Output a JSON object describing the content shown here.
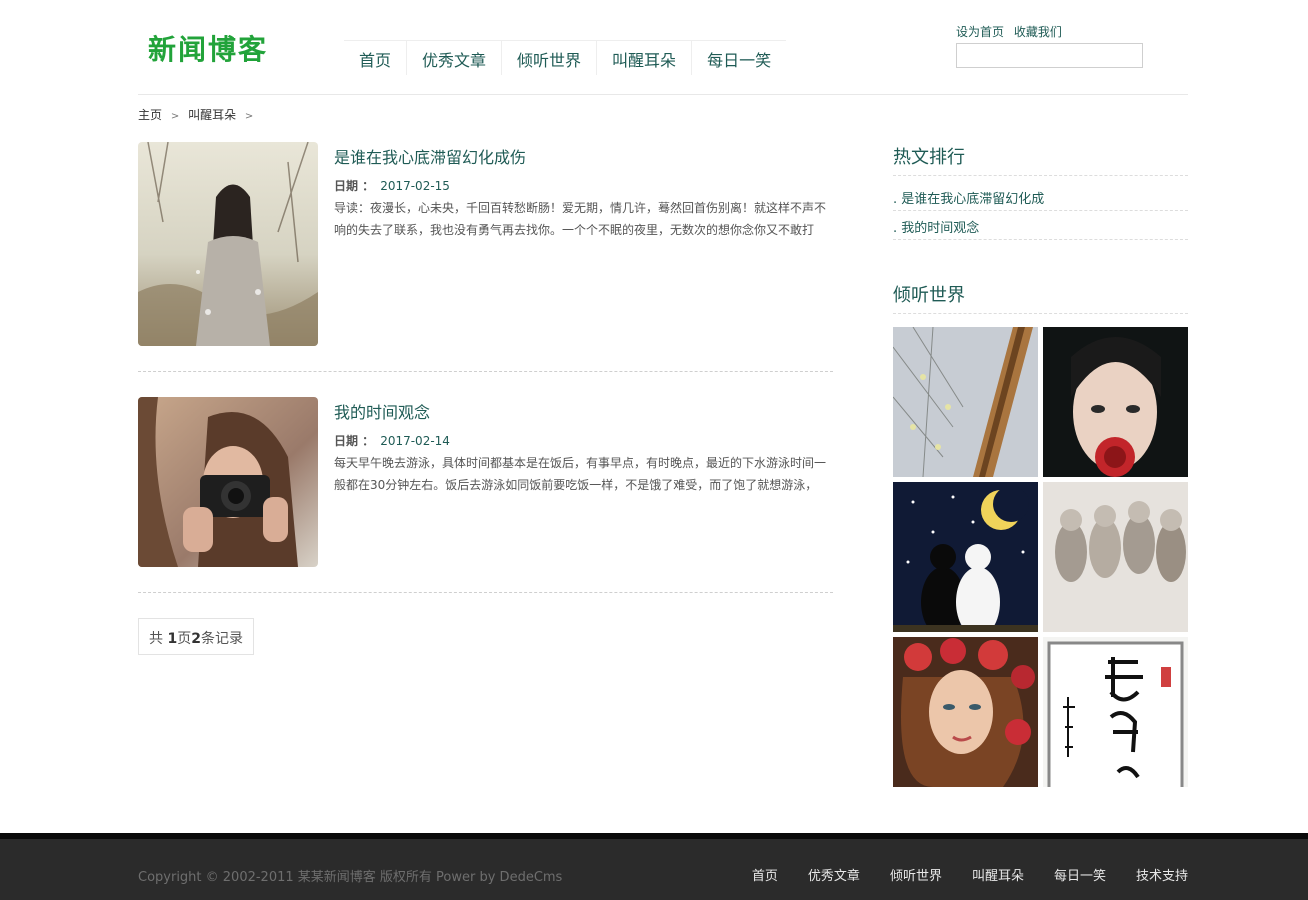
{
  "header": {
    "logo_text": "新闻博客",
    "nav": [
      "首页",
      "优秀文章",
      "倾听世界",
      "叫醒耳朵",
      "每日一笑"
    ],
    "top_links": [
      "设为首页",
      "收藏我们"
    ],
    "search_value": ""
  },
  "breadcrumb": {
    "items": [
      "主页",
      "叫醒耳朵"
    ],
    "separator": ">"
  },
  "articles": [
    {
      "title": "是谁在我心底滞留幻化成伤",
      "date_label": "日期 ：",
      "date": "2017-02-15",
      "summary": "导读：夜漫长，心未央，千回百转愁断肠！爱无期，情几许，蓦然回首伤别离！就这样不声不响的失去了联系，我也没有勇气再去找你。一个个不眠的夜里，无数次的想你念你又不敢打",
      "thumb": "photo-woman-field"
    },
    {
      "title": "我的时间观念",
      "date_label": "日期 ：",
      "date": "2017-02-14",
      "summary": "每天早午晚去游泳，具体时间都基本是在饭后，有事早点，有时晚点，最近的下水游泳时间一般都在30分钟左右。饭后去游泳如同饭前要吃饭一样，不是饿了难受，而了饱了就想游泳，不",
      "thumb": "photo-woman-camera"
    }
  ],
  "pager": {
    "prefix": "共 ",
    "pages": "1",
    "page_word": "页",
    "records": "2",
    "suffix": "条记录"
  },
  "sidebar": {
    "hot_title": "热文排行",
    "hot_items": [
      ". 是谁在我心底滞留幻化成",
      ". 我的时间观念"
    ],
    "gallery_title": "倾听世界"
  },
  "footer": {
    "copyright": "Copyright © 2002-2011 某某新闻博客 版权所有 Power by DedeCms",
    "nav": [
      "首页",
      "优秀文章",
      "倾听世界",
      "叫醒耳朵",
      "每日一笑",
      "技术支持"
    ]
  },
  "colors": {
    "accent": "#1f5b55",
    "logo": "#22a33a",
    "footer_bg": "#2b2b2b"
  }
}
